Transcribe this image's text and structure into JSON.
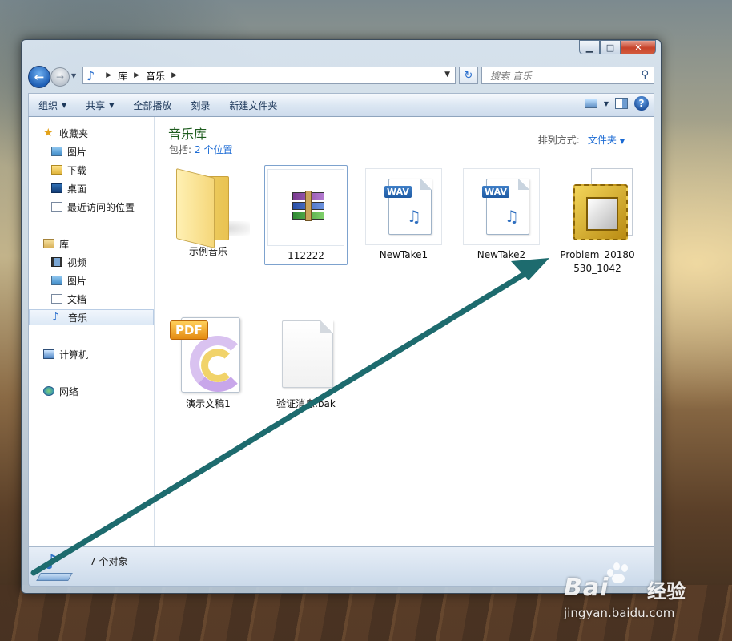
{
  "window": {
    "caption": {
      "minimize": "▁",
      "maximize": "□",
      "close": "✕"
    }
  },
  "address": {
    "segments": [
      "库",
      "音乐"
    ],
    "search_placeholder": "搜索 音乐"
  },
  "toolbar": {
    "organize": "组织",
    "share": "共享",
    "play_all": "全部播放",
    "burn": "刻录",
    "new_folder": "新建文件夹"
  },
  "sidebar": {
    "favorites": {
      "label": "收藏夹",
      "items": [
        "图片",
        "下载",
        "桌面",
        "最近访问的位置"
      ]
    },
    "libraries": {
      "label": "库",
      "items": [
        "视频",
        "图片",
        "文档",
        "音乐"
      ],
      "selected": "音乐"
    },
    "computer": "计算机",
    "network": "网络"
  },
  "library": {
    "title": "音乐库",
    "includes_label": "包括:",
    "includes_link": "2 个位置",
    "arrange_label": "排列方式:",
    "arrange_value": "文件夹"
  },
  "files": [
    {
      "name": "示例音乐",
      "type": "folder"
    },
    {
      "name": "112222",
      "type": "rar",
      "selected": true
    },
    {
      "name": "NewTake1",
      "type": "wav",
      "tag": "WAV"
    },
    {
      "name": "NewTake2",
      "type": "wav",
      "tag": "WAV"
    },
    {
      "name_line1": "Problem_20180",
      "name_line2": "530_1042",
      "type": "psr"
    },
    {
      "name": "演示文稿1",
      "type": "pdf",
      "tag": "PDF"
    },
    {
      "name": "验证消息.bak",
      "type": "blank"
    }
  ],
  "status": {
    "count": "7 个对象"
  },
  "watermark": {
    "brand": "Bai",
    "cn": "经验",
    "url": "jingyan.baidu.com"
  },
  "colors": {
    "arrow": "#1d6b6e",
    "accent": "#1a6ad4",
    "library_title": "#1e5c1e"
  }
}
